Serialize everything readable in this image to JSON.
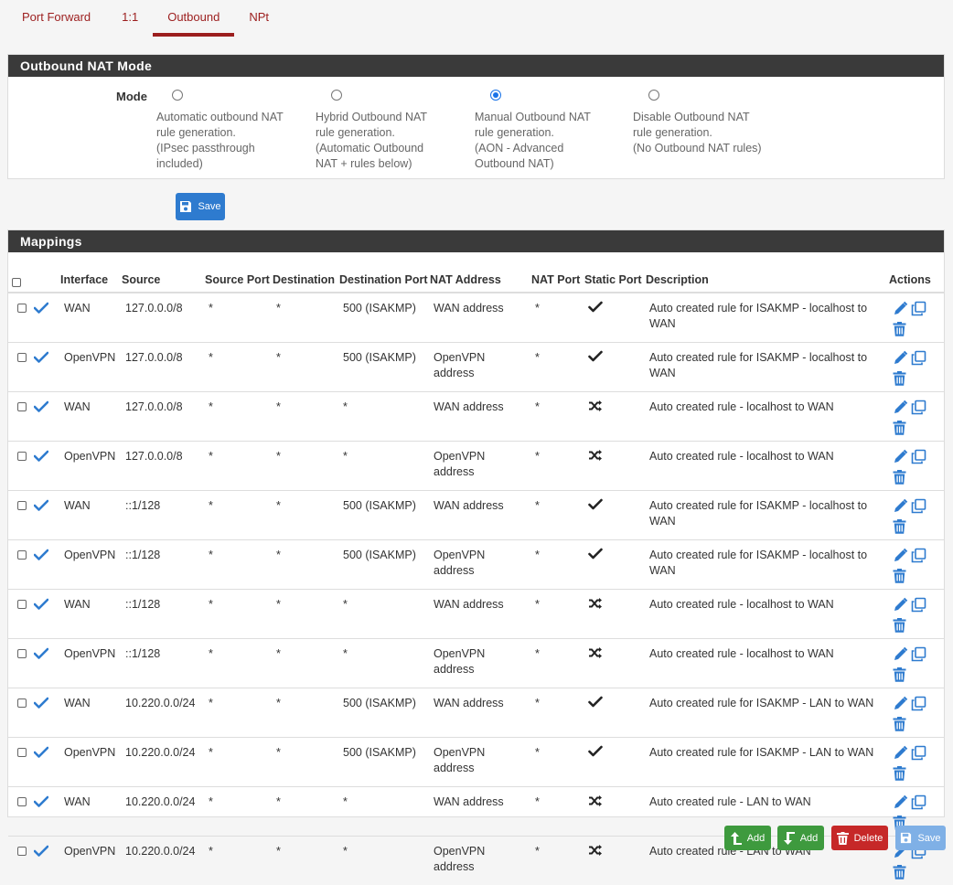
{
  "tabs": [
    "Port Forward",
    "1:1",
    "Outbound",
    "NPt"
  ],
  "nat_mode": {
    "title": "Outbound NAT Mode",
    "mode_label": "Mode",
    "options": [
      {
        "text": "Automatic outbound NAT\nrule generation.\n(IPsec passthrough\nincluded)",
        "selected": false
      },
      {
        "text": "Hybrid Outbound NAT\nrule generation.\n(Automatic Outbound\nNAT + rules below)",
        "selected": false
      },
      {
        "text": "Manual Outbound NAT\nrule generation.\n(AON - Advanced\nOutbound NAT)",
        "selected": true
      },
      {
        "text": "Disable Outbound NAT\nrule generation.\n(No Outbound NAT rules)",
        "selected": false
      }
    ],
    "save_label": "Save"
  },
  "mappings": {
    "title": "Mappings",
    "headers": {
      "interface": "Interface",
      "source": "Source",
      "source_port": "Source Port",
      "destination": "Destination",
      "destination_port": "Destination Port",
      "nat_address": "NAT Address",
      "nat_port": "NAT Port",
      "static_port": "Static Port",
      "description": "Description",
      "actions": "Actions"
    },
    "rows": [
      {
        "interface": "WAN",
        "source": "127.0.0.0/8",
        "source_port": "*",
        "destination": "*",
        "destination_port": "500 (ISAKMP)",
        "nat_address": "WAN address",
        "nat_port": "*",
        "static_port": "check",
        "description": "Auto created rule for ISAKMP - localhost to WAN"
      },
      {
        "interface": "OpenVPN",
        "source": "127.0.0.0/8",
        "source_port": "*",
        "destination": "*",
        "destination_port": "500 (ISAKMP)",
        "nat_address": "OpenVPN address",
        "nat_port": "*",
        "static_port": "check",
        "description": "Auto created rule for ISAKMP - localhost to WAN"
      },
      {
        "interface": "WAN",
        "source": "127.0.0.0/8",
        "source_port": "*",
        "destination": "*",
        "destination_port": "*",
        "nat_address": "WAN address",
        "nat_port": "*",
        "static_port": "random",
        "description": "Auto created rule - localhost to WAN"
      },
      {
        "interface": "OpenVPN",
        "source": "127.0.0.0/8",
        "source_port": "*",
        "destination": "*",
        "destination_port": "*",
        "nat_address": "OpenVPN address",
        "nat_port": "*",
        "static_port": "random",
        "description": "Auto created rule - localhost to WAN"
      },
      {
        "interface": "WAN",
        "source": "::1/128",
        "source_port": "*",
        "destination": "*",
        "destination_port": "500 (ISAKMP)",
        "nat_address": "WAN address",
        "nat_port": "*",
        "static_port": "check",
        "description": "Auto created rule for ISAKMP - localhost to WAN"
      },
      {
        "interface": "OpenVPN",
        "source": "::1/128",
        "source_port": "*",
        "destination": "*",
        "destination_port": "500 (ISAKMP)",
        "nat_address": "OpenVPN address",
        "nat_port": "*",
        "static_port": "check",
        "description": "Auto created rule for ISAKMP - localhost to WAN"
      },
      {
        "interface": "WAN",
        "source": "::1/128",
        "source_port": "*",
        "destination": "*",
        "destination_port": "*",
        "nat_address": "WAN address",
        "nat_port": "*",
        "static_port": "random",
        "description": "Auto created rule - localhost to WAN"
      },
      {
        "interface": "OpenVPN",
        "source": "::1/128",
        "source_port": "*",
        "destination": "*",
        "destination_port": "*",
        "nat_address": "OpenVPN address",
        "nat_port": "*",
        "static_port": "random",
        "description": "Auto created rule - localhost to WAN"
      },
      {
        "interface": "WAN",
        "source": "10.220.0.0/24",
        "source_port": "*",
        "destination": "*",
        "destination_port": "500 (ISAKMP)",
        "nat_address": "WAN address",
        "nat_port": "*",
        "static_port": "check",
        "description": "Auto created rule for ISAKMP - LAN to WAN"
      },
      {
        "interface": "OpenVPN",
        "source": "10.220.0.0/24",
        "source_port": "*",
        "destination": "*",
        "destination_port": "500 (ISAKMP)",
        "nat_address": "OpenVPN address",
        "nat_port": "*",
        "static_port": "check",
        "description": "Auto created rule for ISAKMP - LAN to WAN"
      },
      {
        "interface": "WAN",
        "source": "10.220.0.0/24",
        "source_port": "*",
        "destination": "*",
        "destination_port": "*",
        "nat_address": "WAN address",
        "nat_port": "*",
        "static_port": "random",
        "description": "Auto created rule - LAN to WAN"
      },
      {
        "interface": "OpenVPN",
        "source": "10.220.0.0/24",
        "source_port": "*",
        "destination": "*",
        "destination_port": "*",
        "nat_address": "OpenVPN address",
        "nat_port": "*",
        "static_port": "random",
        "description": "Auto created rule - LAN to WAN"
      }
    ]
  },
  "bottom_buttons": {
    "add_top_label": "Add",
    "add_bottom_label": "Add",
    "delete_label": "Delete",
    "save_label": "Save"
  },
  "colors": {
    "tab_accent": "#9c1e1e",
    "panel_header": "#3a3a3a",
    "icon_blue": "#2e7bcf",
    "btn_green": "#3e9a3e",
    "btn_red": "#c62828"
  }
}
